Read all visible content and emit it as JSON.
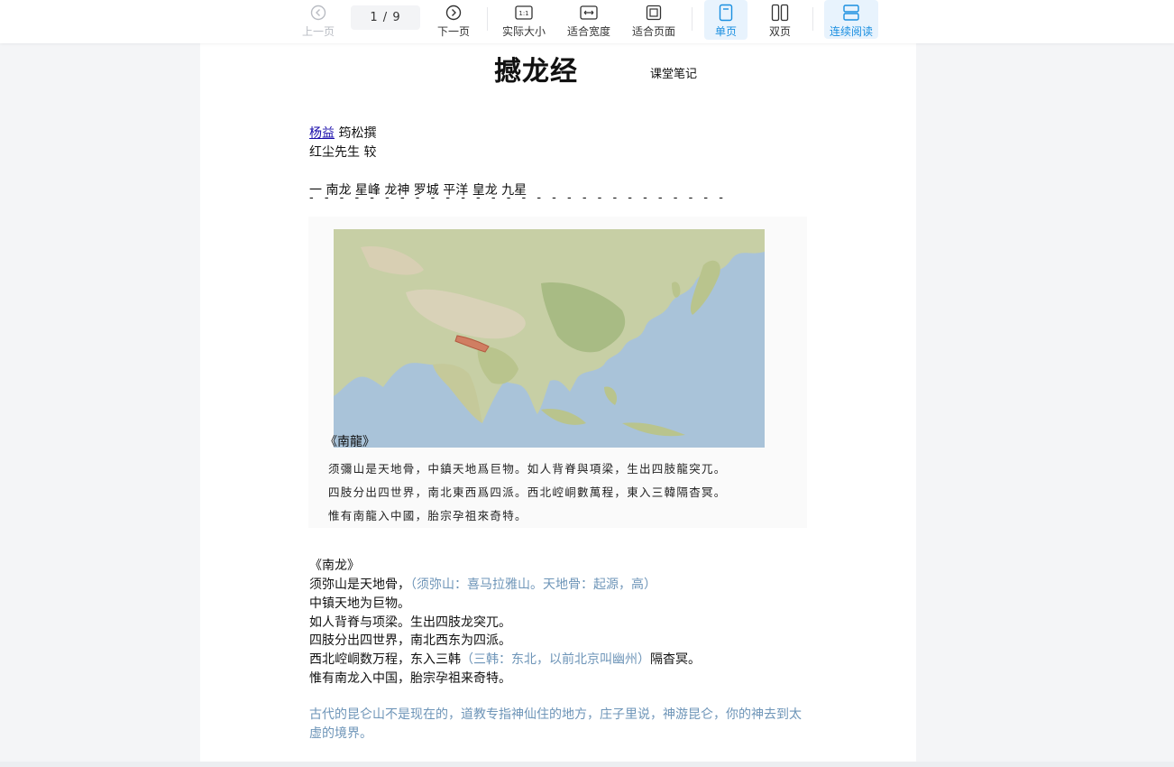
{
  "toolbar": {
    "prev_label": "上一页",
    "next_label": "下一页",
    "page_indicator": "1 / 9",
    "actual_size_label": "实际大小",
    "actual_size_icon_text": "1:1",
    "fit_width_label": "适合宽度",
    "fit_page_label": "适合页面",
    "single_page_label": "单页",
    "double_page_label": "双页",
    "continuous_label": "连续阅读",
    "accent_color": "#1a8fe0"
  },
  "document": {
    "title": "撼龙经",
    "subtitle": "课堂笔记",
    "author_link": "杨益",
    "author_suffix": " 筠松撰",
    "reviewer": "红尘先生 较",
    "chapter_heading": "一 南龙 星峰 龙神 罗城 平洋 皇龙 九星",
    "dashes": "- - - - - - - - - - - - - - - - - - - - - - - - - - - -",
    "figure": {
      "caption": "《南龍》",
      "lines": [
        "须彌山是天地骨，中鎮天地爲巨物。如人背脊與項梁，生出四肢龍突兀。",
        "四肢分出四世界，南北東西爲四派。西北崆峒數萬程，東入三韓隔杳冥。",
        "惟有南龍入中國，胎宗孕祖來奇特。"
      ]
    },
    "section_title": "《南龙》",
    "paragraph": [
      {
        "text": "须弥山是天地骨，",
        "note": "（须弥山：喜马拉雅山。天地骨：起源，高）",
        "after": ""
      },
      {
        "text": "中镇天地为巨物。",
        "note": "",
        "after": ""
      },
      {
        "text": "如人背脊与项梁。生出四肢龙突兀。",
        "note": "",
        "after": ""
      },
      {
        "text": "四肢分出四世界，南北西东为四派。",
        "note": "",
        "after": ""
      },
      {
        "text": "西北崆峒数万程，东入三韩",
        "note": "（三韩：东北，以前北京叫幽州）",
        "after": "隔杳冥。"
      },
      {
        "text": "惟有南龙入中国，胎宗孕祖来奇特。",
        "note": "",
        "after": ""
      }
    ],
    "blue_paragraph": "古代的昆仑山不是现在的，道教专指神仙住的地方，庄子里说，神游昆仑，你的神去到太虚的境界。"
  }
}
